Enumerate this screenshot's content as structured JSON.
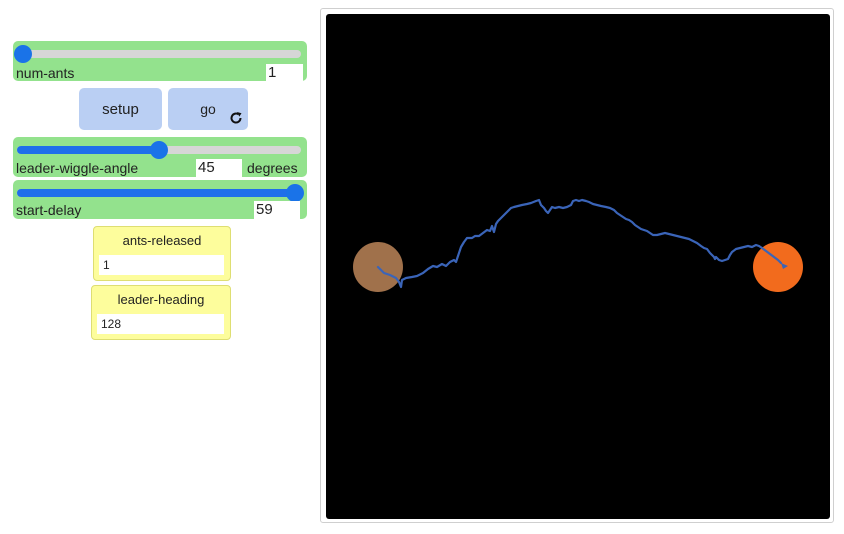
{
  "sliders": {
    "num_ants": {
      "label": "num-ants",
      "value": "1",
      "fraction": 0.0
    },
    "leader_wiggle_angle": {
      "label": "leader-wiggle-angle",
      "value": "45",
      "units": "degrees",
      "fraction": 0.5
    },
    "start_delay": {
      "label": "start-delay",
      "value": "59",
      "fraction": 0.98
    }
  },
  "buttons": {
    "setup": "setup",
    "go": "go"
  },
  "monitors": {
    "ants_released": {
      "label": "ants-released",
      "value": "1"
    },
    "leader_heading": {
      "label": "leader-heading",
      "value": "128"
    }
  },
  "colors": {
    "slider_bg": "#93e28d",
    "button_bg": "#bacff3",
    "monitor_bg": "#fdfd9c",
    "view_bg": "#000000",
    "nest": "#a0714b",
    "food": "#f26b1d",
    "trail": "#3a64b8"
  },
  "icons": {
    "go_forever": "refresh-icon"
  }
}
